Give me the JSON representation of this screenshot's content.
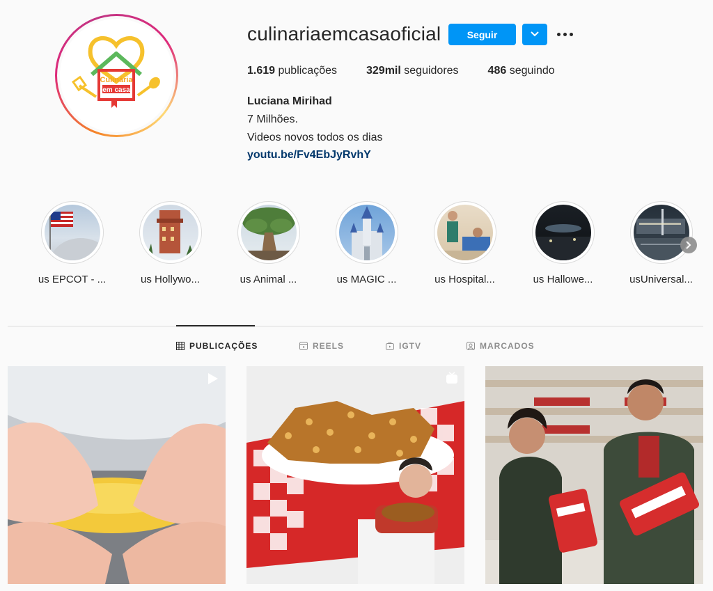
{
  "profile": {
    "username": "culinariaemcasaoficial",
    "follow_label": "Seguir",
    "stats": {
      "posts_count": "1.619",
      "posts_label": "publicações",
      "followers_count": "329mil",
      "followers_label": "seguidores",
      "following_count": "486",
      "following_label": "seguindo"
    },
    "full_name": "Luciana Mirihad",
    "bio_line1": "7 Milhões.",
    "bio_line2": "Videos novos todos os dias",
    "link": "youtu.be/Fv4EbJyRvhY",
    "avatar_logo_text": "Culinária em casa"
  },
  "highlights": [
    {
      "label": "us EPCOT - ..."
    },
    {
      "label": "us Hollywo..."
    },
    {
      "label": "us Animal ..."
    },
    {
      "label": "us MAGIC ..."
    },
    {
      "label": "us Hospital..."
    },
    {
      "label": "us Hallowe..."
    },
    {
      "label": "usUniversal..."
    }
  ],
  "tabs": [
    {
      "label": "PUBLICAÇÕES",
      "icon": "grid-icon",
      "active": true
    },
    {
      "label": "REELS",
      "icon": "reels-icon",
      "active": false
    },
    {
      "label": "IGTV",
      "icon": "igtv-icon",
      "active": false
    },
    {
      "label": "MARCADOS",
      "icon": "tagged-icon",
      "active": false
    }
  ],
  "posts": [
    {
      "kind": "video",
      "icon": "play-icon"
    },
    {
      "kind": "igtv",
      "icon": "igtv-icon"
    },
    {
      "kind": "photo",
      "icon": ""
    }
  ],
  "colors": {
    "accent": "#0095f6",
    "link": "#00376b",
    "text": "#262626",
    "muted": "#8e8e8e",
    "background": "#fafafa"
  }
}
